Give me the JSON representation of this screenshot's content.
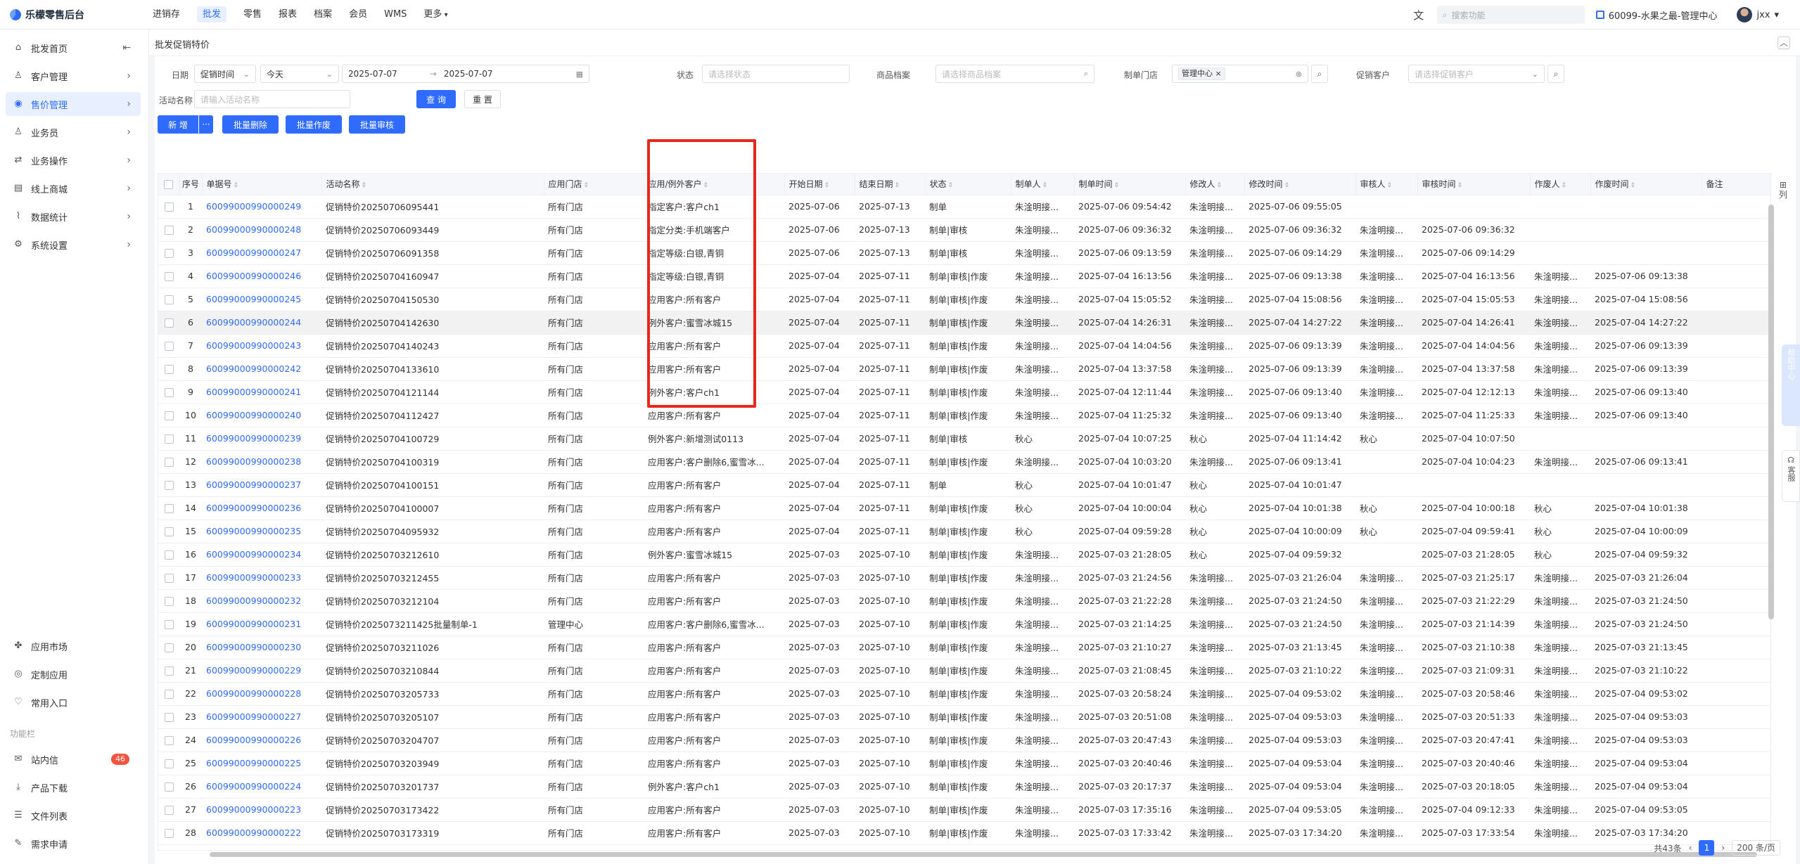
{
  "app": {
    "title": "乐檬零售后台"
  },
  "topnav": [
    "进销存",
    "批发",
    "零售",
    "报表",
    "档案",
    "会员",
    "WMS",
    "更多"
  ],
  "topnav_active": "批发",
  "topright": {
    "search_placeholder": "搜索功能",
    "store": "60099-水果之最-管理中心",
    "user": "jxx"
  },
  "sidebar": {
    "items": [
      {
        "label": "批发首页",
        "icon": "home-icon",
        "arrow": "⇤"
      },
      {
        "label": "客户管理",
        "icon": "user-icon",
        "arrow": "›"
      },
      {
        "label": "售价管理",
        "icon": "price-icon",
        "arrow": "›"
      },
      {
        "label": "业务员",
        "icon": "person-icon",
        "arrow": "›"
      },
      {
        "label": "业务操作",
        "icon": "operation-icon",
        "arrow": "›"
      },
      {
        "label": "线上商城",
        "icon": "mall-icon",
        "arrow": "›"
      },
      {
        "label": "数据统计",
        "icon": "chart-icon",
        "arrow": "›"
      },
      {
        "label": "系统设置",
        "icon": "gear-icon",
        "arrow": "›"
      }
    ],
    "bottom_items": [
      {
        "label": "应用市场",
        "icon": "app-market-icon"
      },
      {
        "label": "定制应用",
        "icon": "custom-app-icon"
      },
      {
        "label": "常用入口",
        "icon": "heart-icon"
      }
    ],
    "section_label": "功能栏",
    "func_items": [
      {
        "label": "站内信",
        "icon": "message-icon",
        "badge": "46"
      },
      {
        "label": "产品下载",
        "icon": "download-icon"
      },
      {
        "label": "文件列表",
        "icon": "file-icon"
      },
      {
        "label": "需求申请",
        "icon": "request-icon"
      }
    ]
  },
  "tab": "批发促销特价",
  "filters": {
    "date_label": "日期",
    "date_type": "促销时间",
    "date_range": "今天",
    "date_start": "2025-07-07",
    "date_arrow": "→",
    "date_end": "2025-07-07",
    "status_label": "状态",
    "status_placeholder": "请选择状态",
    "goods_label": "商品档案",
    "goods_placeholder": "请选择商品档案",
    "store_label": "制单门店",
    "store_tag": "管理中心",
    "customer_label": "促销客户",
    "customer_placeholder": "请选择促销客户",
    "activity_label": "活动名称",
    "activity_placeholder": "请输入活动名称",
    "query": "查 询",
    "reset": "重 置"
  },
  "toolbar": {
    "add": "新 增",
    "more": "···",
    "batch_delete": "批量删除",
    "batch_void": "批量作废",
    "batch_audit": "批量审核"
  },
  "columns": [
    "序号",
    "单据号",
    "活动名称",
    "应用门店",
    "应用/例外客户",
    "开始日期",
    "结束日期",
    "状态",
    "制单人",
    "制单时间",
    "修改人",
    "修改时间",
    "审核人",
    "审核时间",
    "作废人",
    "作废时间",
    "备注"
  ],
  "rows": [
    [
      "1",
      "60099000990000249",
      "促销特价20250706095441",
      "所有门店",
      "指定客户:客户ch1",
      "2025-07-06",
      "2025-07-13",
      "制单",
      "朱淦明接...",
      "2025-07-06 09:54:42",
      "朱淦明接...",
      "2025-07-06 09:55:05",
      "",
      "",
      "",
      ""
    ],
    [
      "2",
      "60099000990000248",
      "促销特价20250706093449",
      "所有门店",
      "指定分类:手机端客户",
      "2025-07-06",
      "2025-07-13",
      "制单|审核",
      "朱淦明接...",
      "2025-07-06 09:36:32",
      "朱淦明接...",
      "2025-07-06 09:36:32",
      "朱淦明接...",
      "2025-07-06 09:36:32",
      "",
      ""
    ],
    [
      "3",
      "60099000990000247",
      "促销特价20250706091358",
      "所有门店",
      "指定等级:白银,青铜",
      "2025-07-06",
      "2025-07-13",
      "制单|审核",
      "朱淦明接...",
      "2025-07-06 09:13:59",
      "朱淦明接...",
      "2025-07-06 09:14:29",
      "朱淦明接...",
      "2025-07-06 09:14:29",
      "",
      ""
    ],
    [
      "4",
      "60099000990000246",
      "促销特价20250704160947",
      "所有门店",
      "指定等级:白银,青铜",
      "2025-07-04",
      "2025-07-11",
      "制单|审核|作废",
      "朱淦明接...",
      "2025-07-04 16:13:56",
      "朱淦明接...",
      "2025-07-06 09:13:38",
      "朱淦明接...",
      "2025-07-04 16:13:56",
      "朱淦明接...",
      "2025-07-06 09:13:38"
    ],
    [
      "5",
      "60099000990000245",
      "促销特价20250704150530",
      "所有门店",
      "应用客户:所有客户",
      "2025-07-04",
      "2025-07-11",
      "制单|审核|作废",
      "朱淦明接...",
      "2025-07-04 15:05:52",
      "朱淦明接...",
      "2025-07-04 15:08:56",
      "朱淦明接...",
      "2025-07-04 15:05:53",
      "朱淦明接...",
      "2025-07-04 15:08:56"
    ],
    [
      "6",
      "60099000990000244",
      "促销特价20250704142630",
      "所有门店",
      "例外客户:蜜雪冰城15",
      "2025-07-04",
      "2025-07-11",
      "制单|审核|作废",
      "朱淦明接...",
      "2025-07-04 14:26:31",
      "朱淦明接...",
      "2025-07-04 14:27:22",
      "朱淦明接...",
      "2025-07-04 14:26:41",
      "朱淦明接...",
      "2025-07-04 14:27:22"
    ],
    [
      "7",
      "60099000990000243",
      "促销特价20250704140243",
      "所有门店",
      "应用客户:所有客户",
      "2025-07-04",
      "2025-07-11",
      "制单|审核|作废",
      "朱淦明接...",
      "2025-07-04 14:04:56",
      "朱淦明接...",
      "2025-07-06 09:13:39",
      "朱淦明接...",
      "2025-07-04 14:04:56",
      "朱淦明接...",
      "2025-07-06 09:13:39"
    ],
    [
      "8",
      "60099000990000242",
      "促销特价20250704133610",
      "所有门店",
      "应用客户:所有客户",
      "2025-07-04",
      "2025-07-11",
      "制单|审核|作废",
      "朱淦明接...",
      "2025-07-04 13:37:58",
      "朱淦明接...",
      "2025-07-06 09:13:39",
      "朱淦明接...",
      "2025-07-04 13:37:58",
      "朱淦明接...",
      "2025-07-06 09:13:39"
    ],
    [
      "9",
      "60099000990000241",
      "促销特价20250704121144",
      "所有门店",
      "例外客户:客户ch1",
      "2025-07-04",
      "2025-07-11",
      "制单|审核|作废",
      "朱淦明接...",
      "2025-07-04 12:11:44",
      "朱淦明接...",
      "2025-07-06 09:13:40",
      "朱淦明接...",
      "2025-07-04 12:12:13",
      "朱淦明接...",
      "2025-07-06 09:13:40"
    ],
    [
      "10",
      "60099000990000240",
      "促销特价20250704112427",
      "所有门店",
      "应用客户:所有客户",
      "2025-07-04",
      "2025-07-11",
      "制单|审核|作废",
      "朱淦明接...",
      "2025-07-04 11:25:32",
      "朱淦明接...",
      "2025-07-06 09:13:40",
      "朱淦明接...",
      "2025-07-04 11:25:33",
      "朱淦明接...",
      "2025-07-06 09:13:40"
    ],
    [
      "11",
      "60099000990000239",
      "促销特价20250704100729",
      "所有门店",
      "例外客户:新增测试0113",
      "2025-07-04",
      "2025-07-11",
      "制单|审核",
      "秋心",
      "2025-07-04 10:07:25",
      "秋心",
      "2025-07-04 11:14:42",
      "秋心",
      "2025-07-04 10:07:50",
      "",
      ""
    ],
    [
      "12",
      "60099000990000238",
      "促销特价20250704100319",
      "所有门店",
      "应用客户:客户删除6,蜜雪冰...",
      "2025-07-04",
      "2025-07-11",
      "制单|审核|作废",
      "朱淦明接...",
      "2025-07-04 10:03:20",
      "朱淦明接...",
      "2025-07-06 09:13:41",
      "",
      "2025-07-04 10:04:23",
      "朱淦明接...",
      "2025-07-06 09:13:41"
    ],
    [
      "13",
      "60099000990000237",
      "促销特价20250704100151",
      "所有门店",
      "应用客户:所有客户",
      "2025-07-04",
      "2025-07-11",
      "制单",
      "秋心",
      "2025-07-04 10:01:47",
      "秋心",
      "2025-07-04 10:01:47",
      "",
      "",
      "",
      ""
    ],
    [
      "14",
      "60099000990000236",
      "促销特价20250704100007",
      "所有门店",
      "应用客户:所有客户",
      "2025-07-04",
      "2025-07-11",
      "制单|审核|作废",
      "秋心",
      "2025-07-04 10:00:04",
      "秋心",
      "2025-07-04 10:01:38",
      "秋心",
      "2025-07-04 10:00:18",
      "秋心",
      "2025-07-04 10:01:38"
    ],
    [
      "15",
      "60099000990000235",
      "促销特价20250704095932",
      "所有门店",
      "应用客户:所有客户",
      "2025-07-04",
      "2025-07-11",
      "制单|审核|作废",
      "秋心",
      "2025-07-04 09:59:28",
      "秋心",
      "2025-07-04 10:00:09",
      "秋心",
      "2025-07-04 09:59:41",
      "秋心",
      "2025-07-04 10:00:09"
    ],
    [
      "16",
      "60099000990000234",
      "促销特价20250703212610",
      "所有门店",
      "例外客户:蜜雪冰城15",
      "2025-07-03",
      "2025-07-10",
      "制单|审核|作废",
      "朱淦明接...",
      "2025-07-03 21:28:05",
      "秋心",
      "2025-07-04 09:59:32",
      "",
      "2025-07-03 21:28:05",
      "秋心",
      "2025-07-04 09:59:32"
    ],
    [
      "17",
      "60099000990000233",
      "促销特价20250703212455",
      "所有门店",
      "应用客户:所有客户",
      "2025-07-03",
      "2025-07-10",
      "制单|审核|作废",
      "朱淦明接...",
      "2025-07-03 21:24:56",
      "朱淦明接...",
      "2025-07-03 21:26:04",
      "朱淦明接...",
      "2025-07-03 21:25:17",
      "朱淦明接...",
      "2025-07-03 21:26:04"
    ],
    [
      "18",
      "60099000990000232",
      "促销特价20250703212104",
      "所有门店",
      "应用客户:所有客户",
      "2025-07-03",
      "2025-07-10",
      "制单|审核|作废",
      "朱淦明接...",
      "2025-07-03 21:22:28",
      "朱淦明接...",
      "2025-07-03 21:24:50",
      "朱淦明接...",
      "2025-07-03 21:22:29",
      "朱淦明接...",
      "2025-07-03 21:24:50"
    ],
    [
      "19",
      "60099000990000231",
      "促销特价2025073211425批量制单-1",
      "管理中心",
      "应用客户:客户删除6,蜜雪冰...",
      "2025-07-03",
      "2025-07-10",
      "制单|审核|作废",
      "朱淦明接...",
      "2025-07-03 21:14:25",
      "朱淦明接...",
      "2025-07-03 21:24:50",
      "朱淦明接...",
      "2025-07-03 21:14:39",
      "朱淦明接...",
      "2025-07-03 21:24:50"
    ],
    [
      "20",
      "60099000990000230",
      "促销特价20250703211026",
      "所有门店",
      "应用客户:所有客户",
      "2025-07-03",
      "2025-07-10",
      "制单|审核|作废",
      "朱淦明接...",
      "2025-07-03 21:10:27",
      "朱淦明接...",
      "2025-07-03 21:13:45",
      "朱淦明接...",
      "2025-07-03 21:10:38",
      "朱淦明接...",
      "2025-07-03 21:13:45"
    ],
    [
      "21",
      "60099000990000229",
      "促销特价20250703210844",
      "所有门店",
      "应用客户:所有客户",
      "2025-07-03",
      "2025-07-10",
      "制单|审核|作废",
      "朱淦明接...",
      "2025-07-03 21:08:45",
      "朱淦明接...",
      "2025-07-03 21:10:22",
      "朱淦明接...",
      "2025-07-03 21:09:31",
      "朱淦明接...",
      "2025-07-03 21:10:22"
    ],
    [
      "22",
      "60099000990000228",
      "促销特价20250703205733",
      "所有门店",
      "应用客户:所有客户",
      "2025-07-03",
      "2025-07-10",
      "制单|审核|作废",
      "朱淦明接...",
      "2025-07-03 20:58:24",
      "朱淦明接...",
      "2025-07-04 09:53:02",
      "朱淦明接...",
      "2025-07-03 20:58:46",
      "朱淦明接...",
      "2025-07-04 09:53:02"
    ],
    [
      "23",
      "60099000990000227",
      "促销特价20250703205107",
      "所有门店",
      "应用客户:所有客户",
      "2025-07-03",
      "2025-07-10",
      "制单|审核|作废",
      "朱淦明接...",
      "2025-07-03 20:51:08",
      "朱淦明接...",
      "2025-07-04 09:53:03",
      "朱淦明接...",
      "2025-07-03 20:51:33",
      "朱淦明接...",
      "2025-07-04 09:53:03"
    ],
    [
      "24",
      "60099000990000226",
      "促销特价20250703204707",
      "所有门店",
      "应用客户:所有客户",
      "2025-07-03",
      "2025-07-10",
      "制单|审核|作废",
      "朱淦明接...",
      "2025-07-03 20:47:43",
      "朱淦明接...",
      "2025-07-04 09:53:03",
      "朱淦明接...",
      "2025-07-03 20:47:41",
      "朱淦明接...",
      "2025-07-04 09:53:03"
    ],
    [
      "25",
      "60099000990000225",
      "促销特价20250703203949",
      "所有门店",
      "应用客户:所有客户",
      "2025-07-03",
      "2025-07-10",
      "制单|审核|作废",
      "朱淦明接...",
      "2025-07-03 20:40:46",
      "朱淦明接...",
      "2025-07-04 09:53:04",
      "朱淦明接...",
      "2025-07-03 20:40:46",
      "朱淦明接...",
      "2025-07-04 09:53:04"
    ],
    [
      "26",
      "60099000990000224",
      "促销特价20250703201737",
      "所有门店",
      "例外客户:客户ch1",
      "2025-07-03",
      "2025-07-10",
      "制单|审核|作废",
      "朱淦明接...",
      "2025-07-03 20:17:37",
      "朱淦明接...",
      "2025-07-04 09:53:04",
      "朱淦明接...",
      "2025-07-03 20:18:05",
      "朱淦明接...",
      "2025-07-04 09:53:04"
    ],
    [
      "27",
      "60099000990000223",
      "促销特价20250703173422",
      "所有门店",
      "应用客户:所有客户",
      "2025-07-03",
      "2025-07-10",
      "制单|审核|作废",
      "朱淦明接...",
      "2025-07-03 17:35:16",
      "朱淦明接...",
      "2025-07-04 09:53:05",
      "朱淦明接...",
      "2025-07-04 09:12:33",
      "朱淦明接...",
      "2025-07-04 09:53:05"
    ],
    [
      "28",
      "60099000990000222",
      "促销特价20250703173319",
      "所有门店",
      "应用客户:所有客户",
      "2025-07-03",
      "2025-07-10",
      "制单|审核|作废",
      "朱淦明接...",
      "2025-07-03 17:33:42",
      "朱淦明接...",
      "2025-07-03 17:34:20",
      "朱淦明接...",
      "2025-07-03 17:33:54",
      "朱淦明接...",
      "2025-07-03 17:34:20"
    ]
  ],
  "pager": {
    "total": "共43条",
    "prev": "‹",
    "page": "1",
    "next": "›",
    "size": "200 条/页"
  },
  "col_setting": "列",
  "help_float": "帮助中心",
  "service_float": "客服",
  "colors": {
    "accent": "#2f6bff",
    "highlight": "#e8261c",
    "status_green": "#1aa260"
  }
}
